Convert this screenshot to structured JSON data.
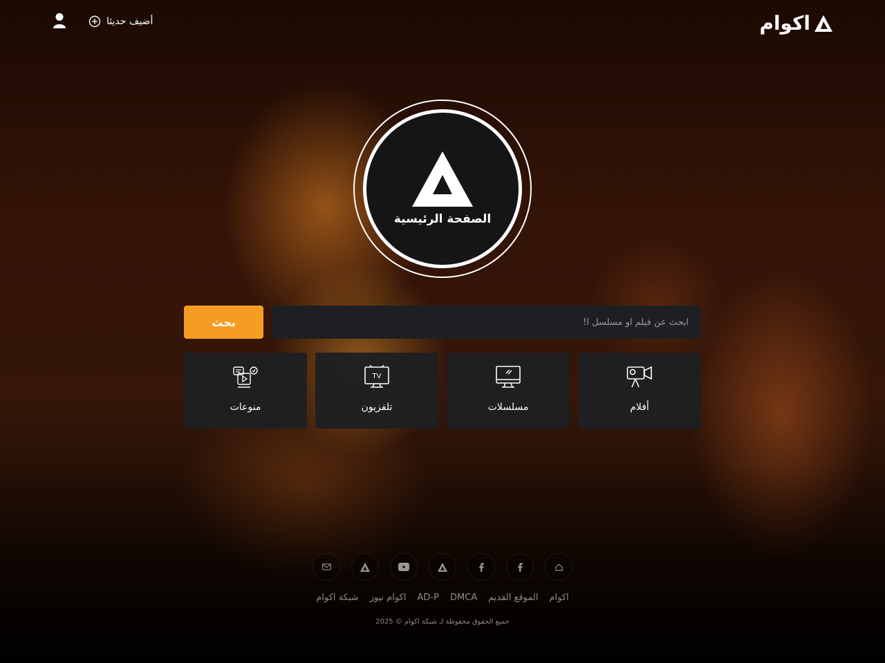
{
  "header": {
    "logo_text": "اكوام",
    "add_recent_label": "أضيف حديثا"
  },
  "hero": {
    "home_label": "الصفحة الرئيسية"
  },
  "search": {
    "placeholder": "ابحث عن فيلم او مسلسل ا!",
    "button_label": "بحث"
  },
  "categories": [
    {
      "label": "أفلام",
      "icon": "movie-camera-icon"
    },
    {
      "label": "مسلسلات",
      "icon": "monitor-icon"
    },
    {
      "label": "تلفزيون",
      "icon": "tv-icon"
    },
    {
      "label": "منوعات",
      "icon": "media-mix-icon"
    }
  ],
  "footer": {
    "social_icons": [
      "home-icon",
      "facebook-icon",
      "facebook-icon",
      "akwam-icon",
      "youtube-icon",
      "akwam-icon",
      "mail-icon"
    ],
    "links": [
      "اكوام",
      "الموقع القديم",
      "DMCA",
      "AD-P",
      "اكوام نيوز",
      "شبكة اكوام"
    ],
    "copyright": "جميع الحقوق محفوظة لـ شبكة اكوام © 2025"
  },
  "colors": {
    "accent": "#f59d22",
    "card_bg": "#1e1f22",
    "hero_bg": "#151518"
  }
}
